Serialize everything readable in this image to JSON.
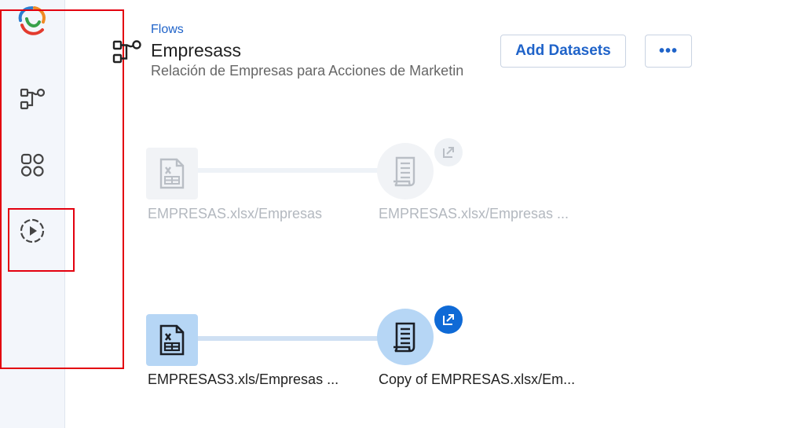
{
  "sidebar": {
    "logo_icon": "spiral-logo-icon",
    "items": [
      {
        "name": "flows-icon"
      },
      {
        "name": "apps-grid-icon"
      },
      {
        "name": "play-circle-icon"
      }
    ]
  },
  "header": {
    "breadcrumb": "Flows",
    "title": "Empresass",
    "subtitle": "Relación de Empresas para Acciones de Marketin",
    "add_button": "Add Datasets",
    "more_button": "•••"
  },
  "flow": {
    "rows": [
      {
        "source_label": "EMPRESAS.xlsx/Empresas",
        "output_label": "EMPRESAS.xlsx/Empresas ...",
        "state": "faded"
      },
      {
        "source_label": "EMPRESAS3.xls/Empresas ...",
        "output_label": "Copy of EMPRESAS.xlsx/Em...",
        "state": "active"
      }
    ]
  },
  "colors": {
    "accent": "#1f63c9",
    "highlight": "#e3000f",
    "node_active": "#b6d6f5",
    "badge_active": "#0f6ad6"
  }
}
